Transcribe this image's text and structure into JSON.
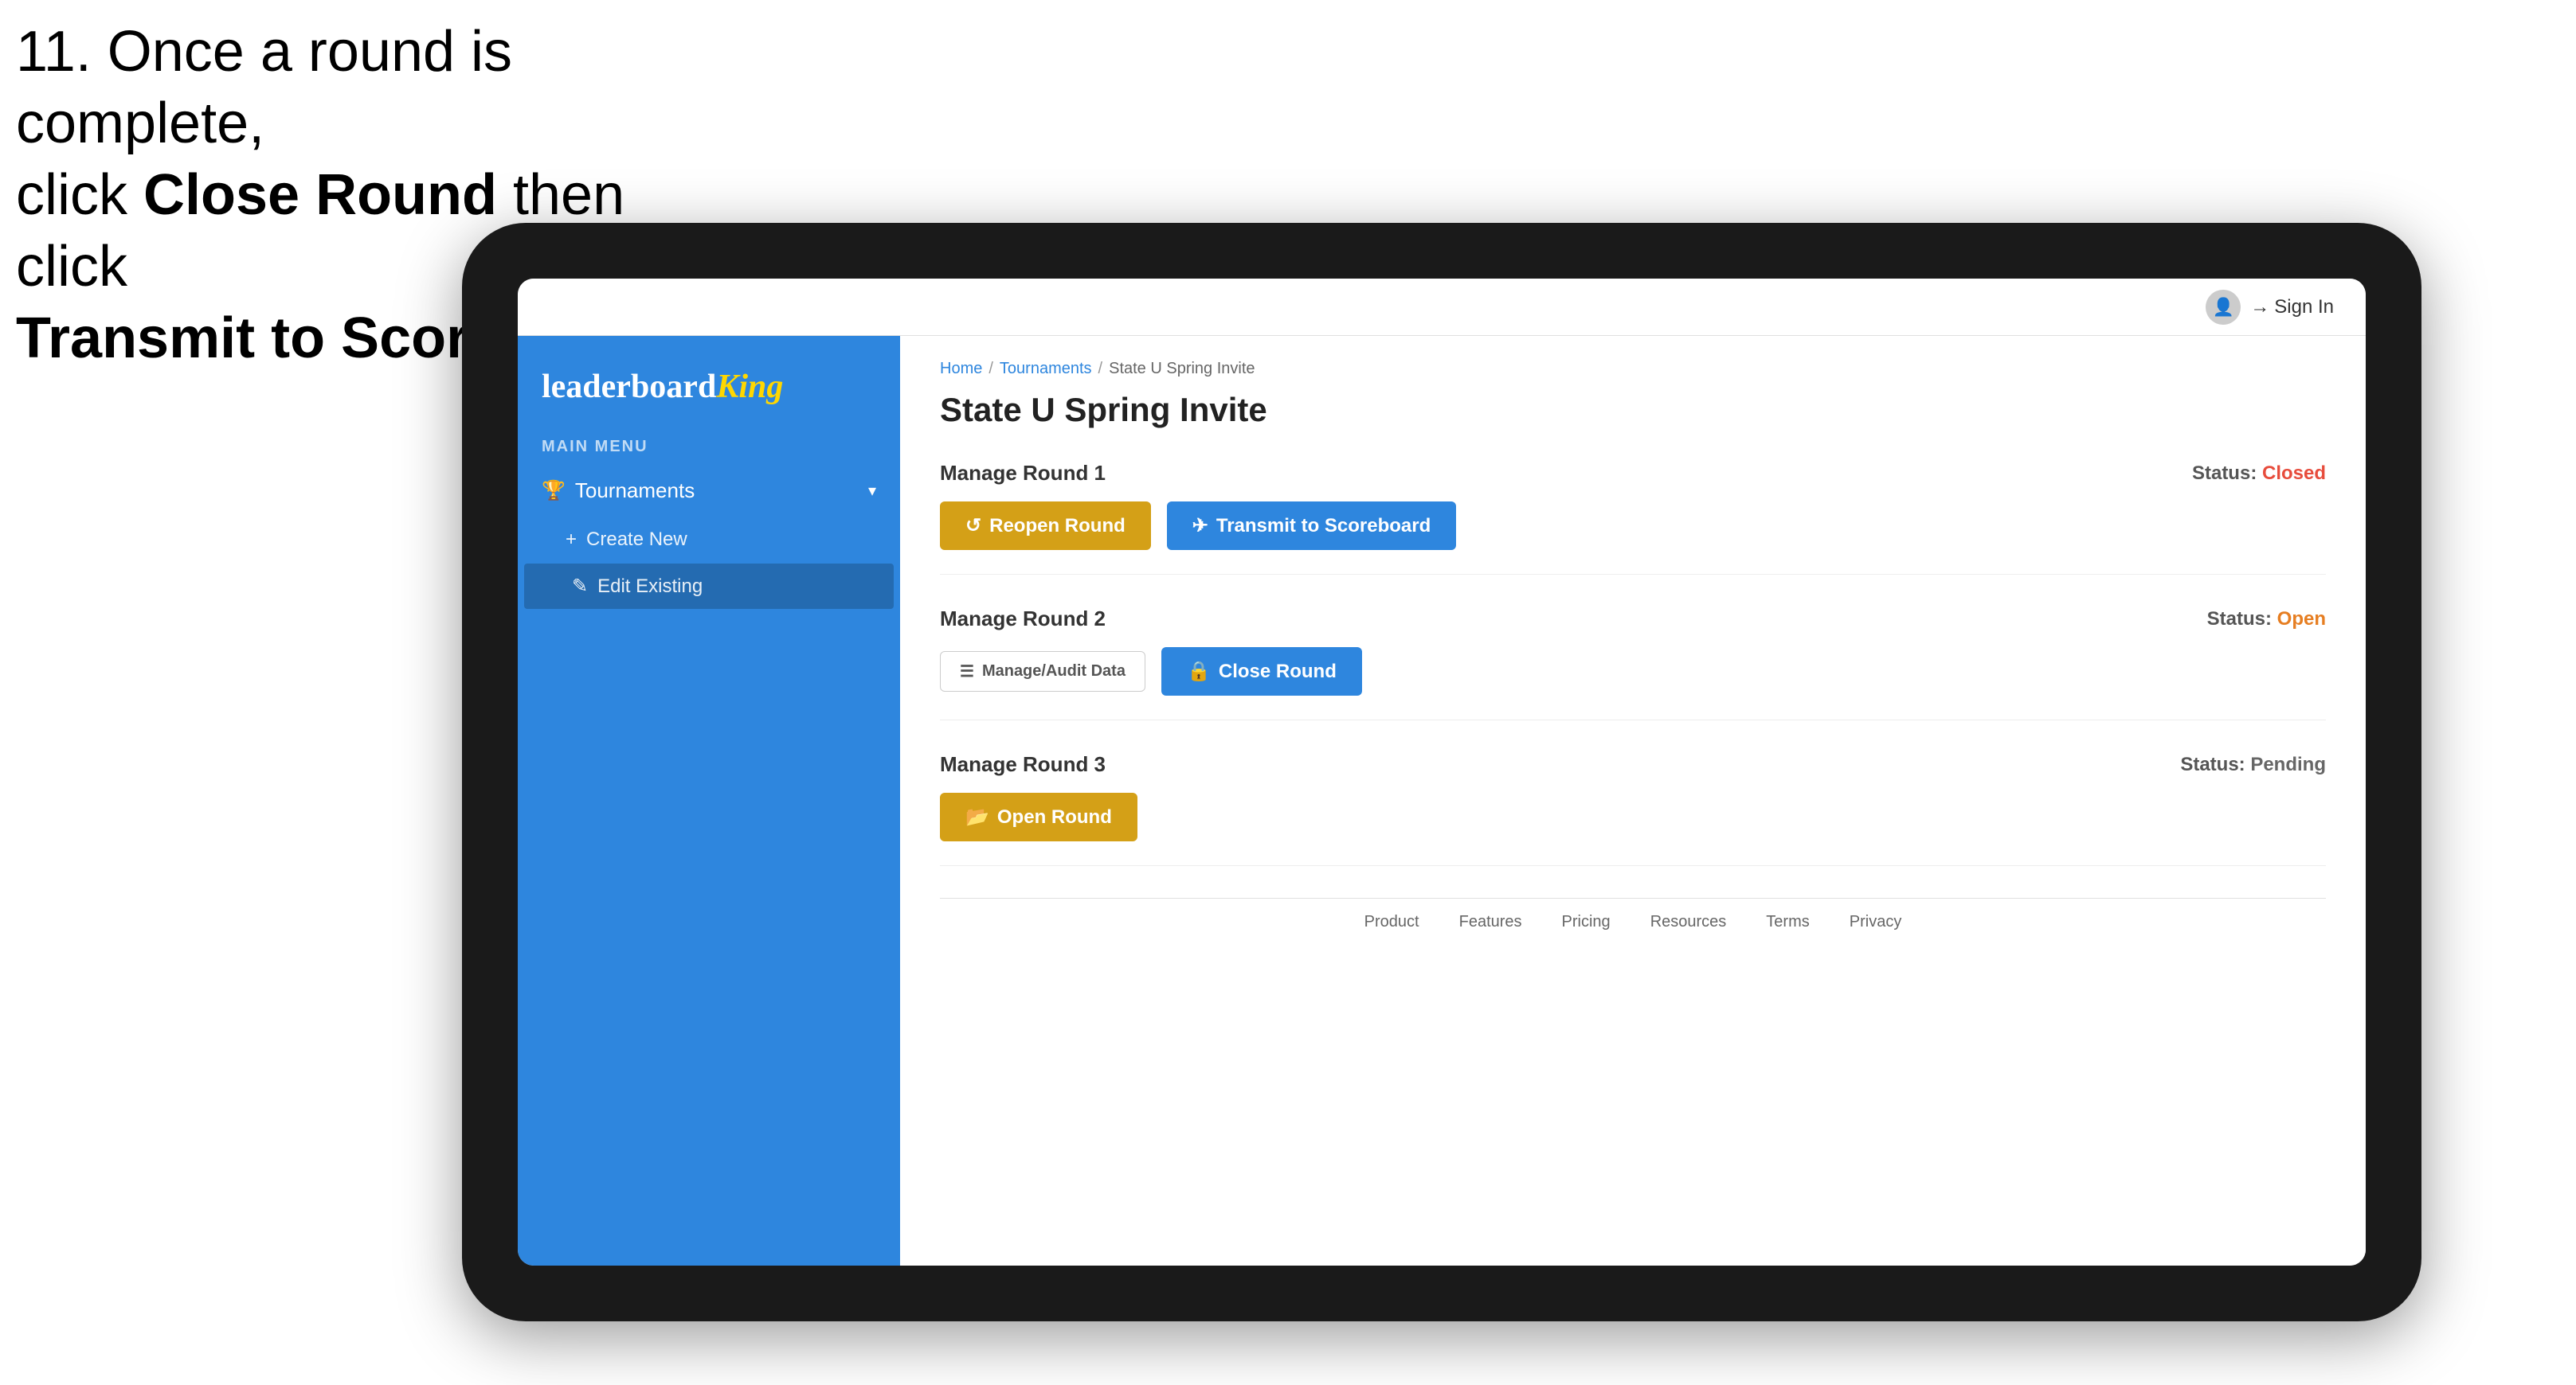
{
  "instruction": {
    "line1": "11. Once a round is complete,",
    "line2_prefix": "click ",
    "line2_bold": "Close Round",
    "line2_suffix": " then click",
    "line3_bold": "Transmit to Scoreboard."
  },
  "header": {
    "sign_in_label": "Sign In"
  },
  "sidebar": {
    "logo": "leaderboard",
    "logo_king": "King",
    "main_menu_label": "MAIN MENU",
    "tournaments_label": "Tournaments",
    "create_new_label": "Create New",
    "edit_existing_label": "Edit Existing"
  },
  "breadcrumb": {
    "home": "Home",
    "sep1": "/",
    "tournaments": "Tournaments",
    "sep2": "/",
    "current": "State U Spring Invite"
  },
  "page": {
    "title": "State U Spring Invite"
  },
  "rounds": [
    {
      "id": "round1",
      "title": "Manage Round 1",
      "status_label": "Status:",
      "status_value": "Closed",
      "status_type": "closed",
      "left_button_label": "Reopen Round",
      "left_button_icon": "↺",
      "right_button_label": "Transmit to Scoreboard",
      "right_button_icon": "✈",
      "right_button_type": "blue"
    },
    {
      "id": "round2",
      "title": "Manage Round 2",
      "status_label": "Status:",
      "status_value": "Open",
      "status_type": "open",
      "left_button_label": "Manage/Audit Data",
      "left_button_icon": "☰",
      "right_button_label": "Close Round",
      "right_button_icon": "🔒",
      "right_button_type": "blue"
    },
    {
      "id": "round3",
      "title": "Manage Round 3",
      "status_label": "Status:",
      "status_value": "Pending",
      "status_type": "pending",
      "left_button_label": "Open Round",
      "left_button_icon": "📂",
      "right_button_label": null
    }
  ],
  "footer": {
    "links": [
      "Product",
      "Features",
      "Pricing",
      "Resources",
      "Terms",
      "Privacy"
    ]
  }
}
